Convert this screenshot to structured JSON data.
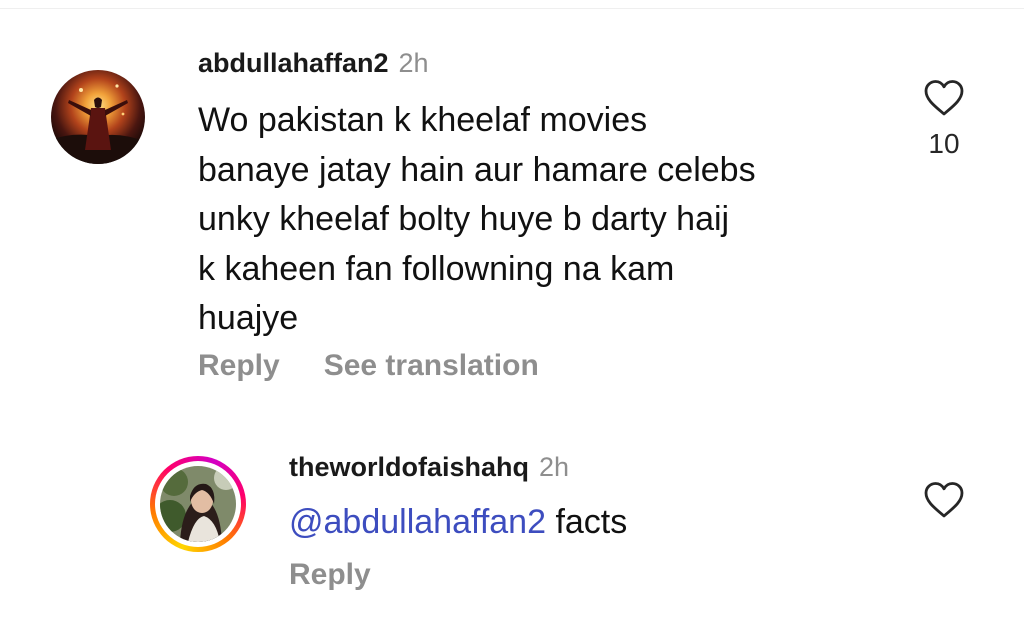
{
  "comments": [
    {
      "username": "abdullahaffan2",
      "time": "2h",
      "text_lines": [
        "Wo pakistan k kheelaf movies",
        "banaye jatay hain aur hamare celebs",
        "unky kheelaf bolty huye b darty haij",
        "k kaheen fan followning na kam",
        "huajye"
      ],
      "like_count": "10",
      "reply_label": "Reply",
      "translate_label": "See translation",
      "avatar_icon": "profile-photo-dark-fiery",
      "like_icon": "heart-outline-icon"
    },
    {
      "username": "theworldofaishahq",
      "time": "2h",
      "mention": "@abdullahaffan2",
      "text": "facts",
      "reply_label": "Reply",
      "avatar_icon": "profile-photo-with-story-ring",
      "like_icon": "heart-outline-icon"
    }
  ],
  "colors": {
    "mention": "#3d4dbf",
    "muted": "#8e8e8e",
    "text": "#111111",
    "story_ring": [
      "#ffd600",
      "#ff7a00",
      "#ff0069",
      "#d300c5"
    ]
  }
}
